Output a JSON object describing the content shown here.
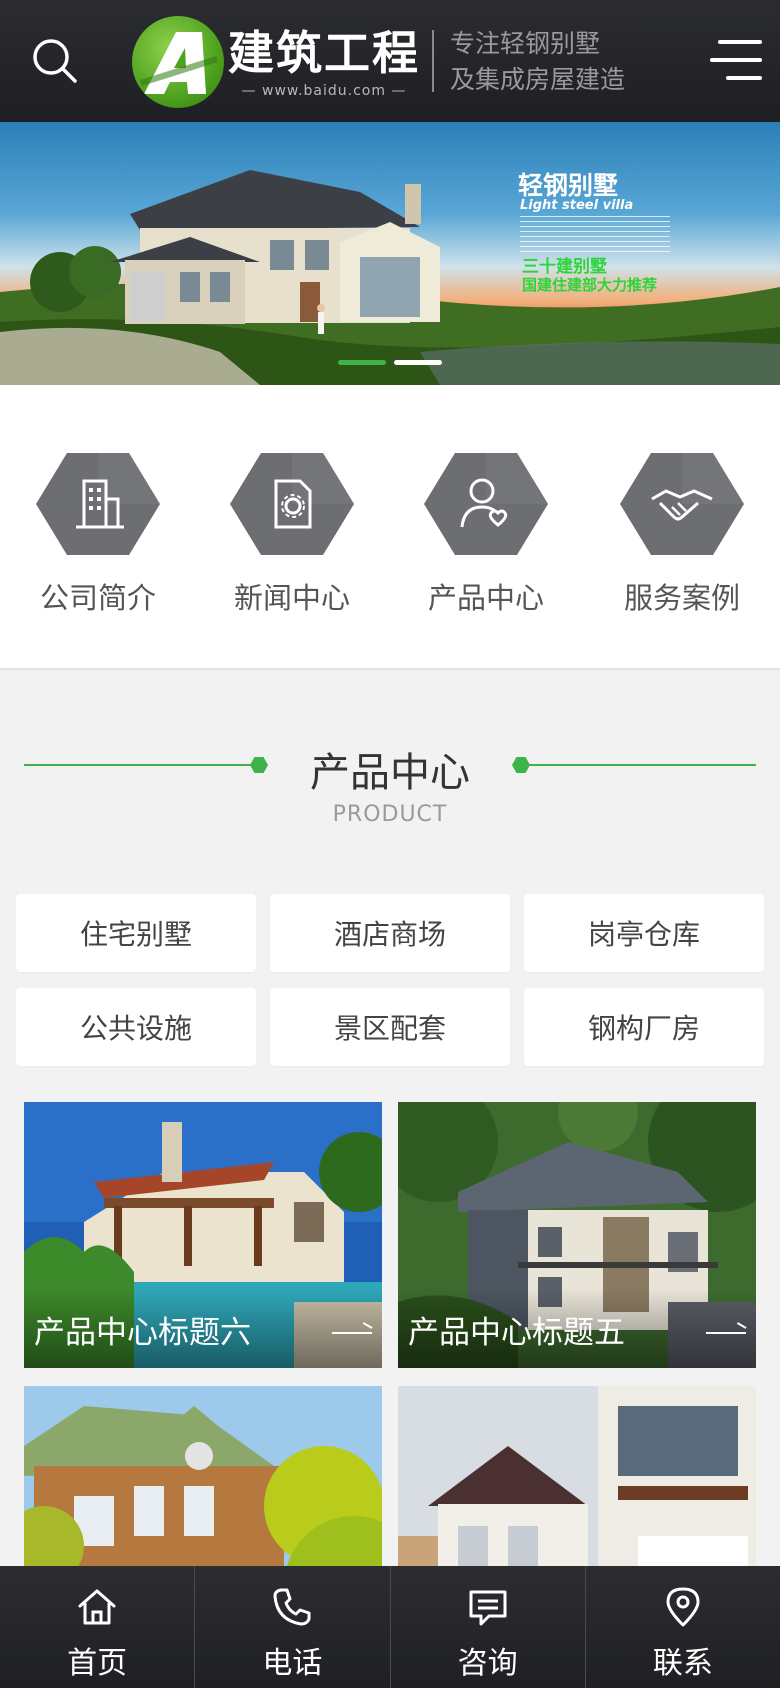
{
  "header": {
    "logo_title": "建筑工程",
    "logo_url": "— www.baidu.com —",
    "slogan_line1": "专注轻钢别墅",
    "slogan_line2": "及集成房屋建造"
  },
  "banner": {
    "title": "轻钢别墅",
    "subtitle": "Light steel villa",
    "tag1": "三十建别墅",
    "tag2": "国建住建部大力推荐",
    "slide_count": 2,
    "active_slide": 1
  },
  "quick_nav": [
    {
      "label": "公司简介",
      "icon": "building-icon"
    },
    {
      "label": "新闻中心",
      "icon": "document-gear-icon"
    },
    {
      "label": "产品中心",
      "icon": "user-heart-icon"
    },
    {
      "label": "服务案例",
      "icon": "handshake-icon"
    }
  ],
  "product_section": {
    "title": "产品中心",
    "subtitle": "PRODUCT",
    "categories": [
      "住宅别墅",
      "酒店商场",
      "岗亭仓库",
      "公共设施",
      "景区配套",
      "钢构厂房"
    ],
    "cards": [
      {
        "title": "产品中心标题六"
      },
      {
        "title": "产品中心标题五"
      },
      {
        "title": ""
      },
      {
        "title": ""
      }
    ]
  },
  "bottom_bar": [
    {
      "label": "首页",
      "icon": "home-icon"
    },
    {
      "label": "电话",
      "icon": "phone-icon"
    },
    {
      "label": "咨询",
      "icon": "chat-icon"
    },
    {
      "label": "联系",
      "icon": "location-pin-icon"
    }
  ],
  "colors": {
    "accent_green": "#3db34a",
    "header_bg": "#26272b",
    "hex_icon_bg": "#6d6e72"
  }
}
